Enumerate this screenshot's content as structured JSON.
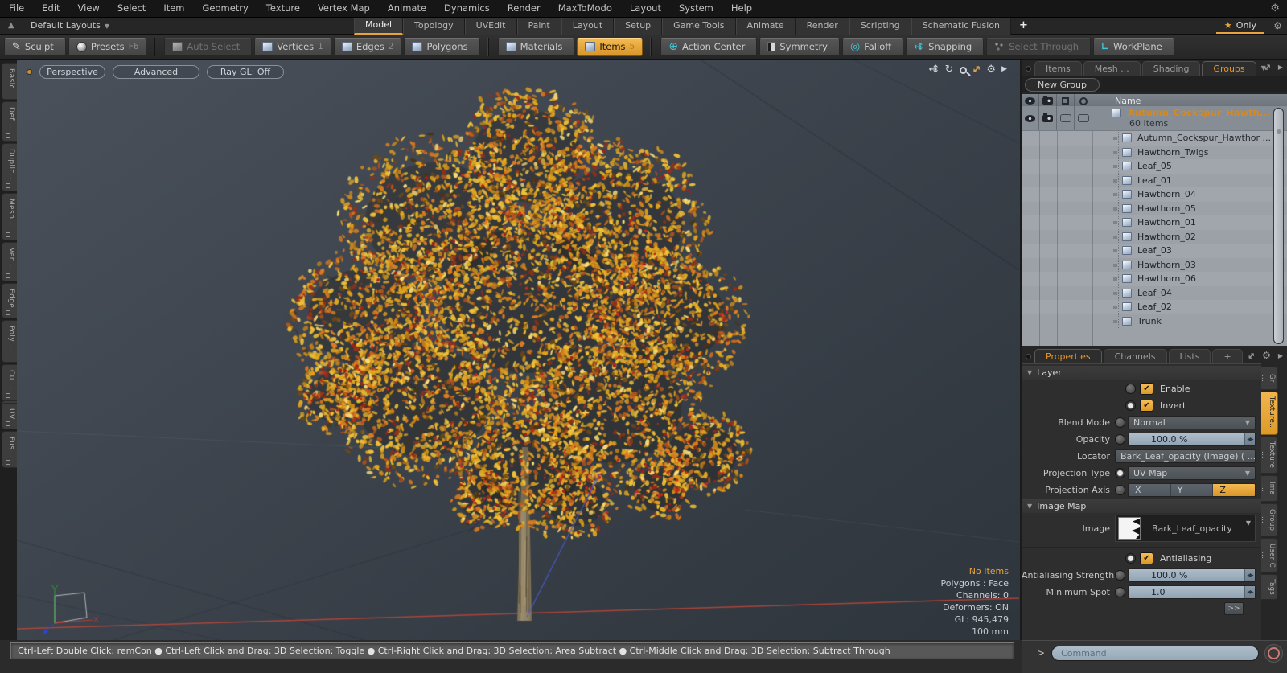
{
  "menu": {
    "items": [
      "File",
      "Edit",
      "View",
      "Select",
      "Item",
      "Geometry",
      "Texture",
      "Vertex Map",
      "Animate",
      "Dynamics",
      "Render",
      "MaxToModo",
      "Layout",
      "System",
      "Help"
    ]
  },
  "layout_bar": {
    "default_layouts_label": "Default Layouts",
    "tabs": [
      {
        "label": "Model",
        "active": true
      },
      {
        "label": "Topology"
      },
      {
        "label": "UVEdit"
      },
      {
        "label": "Paint"
      },
      {
        "label": "Layout"
      },
      {
        "label": "Setup"
      },
      {
        "label": "Game Tools"
      },
      {
        "label": "Animate"
      },
      {
        "label": "Render"
      },
      {
        "label": "Scripting"
      },
      {
        "label": "Schematic Fusion"
      }
    ],
    "add_tab": "+",
    "only_label": "Only"
  },
  "toolbar": {
    "groups": [
      [
        {
          "label": "Sculpt",
          "icon": "pencil"
        },
        {
          "label": "Presets",
          "shortcut": "F6",
          "icon": "sphere"
        }
      ],
      [
        {
          "label": "Auto Select",
          "icon": "cube",
          "disabled": true
        },
        {
          "label": "Vertices",
          "shortcut": "1",
          "icon": "cube"
        },
        {
          "label": "Edges",
          "shortcut": "2",
          "icon": "cube"
        },
        {
          "label": "Polygons",
          "icon": "cube"
        }
      ],
      [
        {
          "label": "Materials",
          "icon": "cube"
        },
        {
          "label": "Items",
          "shortcut": "5",
          "icon": "cube",
          "active": true
        }
      ],
      [
        {
          "label": "Action Center",
          "icon": "action-center"
        },
        {
          "label": "Symmetry",
          "icon": "symmetry"
        },
        {
          "label": "Falloff",
          "icon": "falloff"
        },
        {
          "label": "Snapping",
          "icon": "snapping"
        },
        {
          "label": "Select Through",
          "icon": "select-through",
          "disabled": true
        },
        {
          "label": "WorkPlane",
          "icon": "workplane"
        }
      ]
    ]
  },
  "left_tabs": [
    "Basic",
    "Def ...",
    "Duplic...",
    "Mesh ...",
    "Ver ...",
    "Edge",
    "Poly ...",
    "Cu ...",
    "UV",
    "Fus..."
  ],
  "viewport": {
    "header_buttons": [
      "Perspective",
      "Advanced",
      "Ray GL: Off"
    ],
    "info": {
      "highlight": "No Items",
      "lines": [
        "Polygons : Face",
        "Channels: 0",
        "Deformers: ON",
        "GL: 945,479",
        "100 mm"
      ]
    }
  },
  "groups": {
    "tabs": [
      {
        "label": "Items"
      },
      {
        "label": "Mesh ..."
      },
      {
        "label": "Shading"
      },
      {
        "label": "Groups",
        "active": true
      }
    ],
    "new_group": "New Group",
    "name_header": "Name",
    "root": {
      "label": "Autumn_Cockspur_Hawth...",
      "count": "60 Items"
    },
    "items": [
      {
        "label": "Autumn_Cockspur_Hawthor ...",
        "icon": "locator"
      },
      {
        "label": "Hawthorn_Twigs",
        "icon": "mesh"
      },
      {
        "label": "Leaf_05",
        "icon": "mesh"
      },
      {
        "label": "Leaf_01",
        "icon": "mesh"
      },
      {
        "label": "Hawthorn_04",
        "icon": "mesh"
      },
      {
        "label": "Hawthorn_05",
        "icon": "mesh"
      },
      {
        "label": "Hawthorn_01",
        "icon": "mesh"
      },
      {
        "label": "Hawthorn_02",
        "icon": "mesh"
      },
      {
        "label": "Leaf_03",
        "icon": "mesh"
      },
      {
        "label": "Hawthorn_03",
        "icon": "mesh"
      },
      {
        "label": "Hawthorn_06",
        "icon": "mesh"
      },
      {
        "label": "Leaf_04",
        "icon": "mesh"
      },
      {
        "label": "Leaf_02",
        "icon": "mesh"
      },
      {
        "label": "Trunk",
        "icon": "mesh"
      }
    ]
  },
  "props": {
    "tabs": [
      {
        "label": "Properties",
        "active": true
      },
      {
        "label": "Channels"
      },
      {
        "label": "Lists"
      },
      {
        "label": "+"
      }
    ],
    "sections": {
      "layer": "Layer",
      "image_map": "Image Map"
    },
    "enable": {
      "label": "Enable",
      "checked": true
    },
    "invert": {
      "label": "Invert",
      "checked": true
    },
    "blend_mode": {
      "label": "Blend Mode",
      "value": "Normal"
    },
    "opacity": {
      "label": "Opacity",
      "value": "100.0 %"
    },
    "locator": {
      "label": "Locator",
      "value": "Bark_Leaf_opacity (Image) ( ..."
    },
    "projection_type": {
      "label": "Projection Type",
      "value": "UV Map"
    },
    "projection_axis": {
      "label": "Projection Axis",
      "options": [
        "X",
        "Y",
        "Z"
      ],
      "selected": "Z"
    },
    "image": {
      "label": "Image",
      "value": "Bark_Leaf_opacity"
    },
    "antialiasing": {
      "label": "Antialiasing",
      "checked": true
    },
    "antialiasing_strength": {
      "label": "Antialiasing Strength",
      "value": "100.0 %"
    },
    "minimum_spot": {
      "label": "Minimum Spot",
      "value": "1.0"
    },
    "more_button": ">>"
  },
  "right_tabs": [
    {
      "label": "Gr ..."
    },
    {
      "label": "Texture...",
      "active": true
    },
    {
      "label": "Texture ..."
    },
    {
      "label": "Ima ..."
    },
    {
      "label": "Group ..."
    },
    {
      "label": "User C ..."
    },
    {
      "label": "Tags"
    }
  ],
  "status_bar": {
    "text": "Ctrl-Left Double Click: remCon ●  Ctrl-Left Click and Drag: 3D Selection: Toggle ●  Ctrl-Right Click and Drag: 3D Selection: Area Subtract ●  Ctrl-Middle Click and Drag: 3D Selection: Subtract Through"
  },
  "command": {
    "prompt": ">",
    "placeholder": "Command"
  },
  "scene": {
    "foliage_palette": [
      "#e2a51e",
      "#f0c238",
      "#c8861a",
      "#e07a1e",
      "#b5541a",
      "#93301a",
      "#6e4a16",
      "#f6dd7a",
      "#4a3412"
    ],
    "berry_color": "#a61f15",
    "trunk_color": "#8d7f63",
    "axis_x_color": "#c0473a",
    "axis_z_color": "#4a5bd8",
    "accent": "#e8a33d"
  }
}
